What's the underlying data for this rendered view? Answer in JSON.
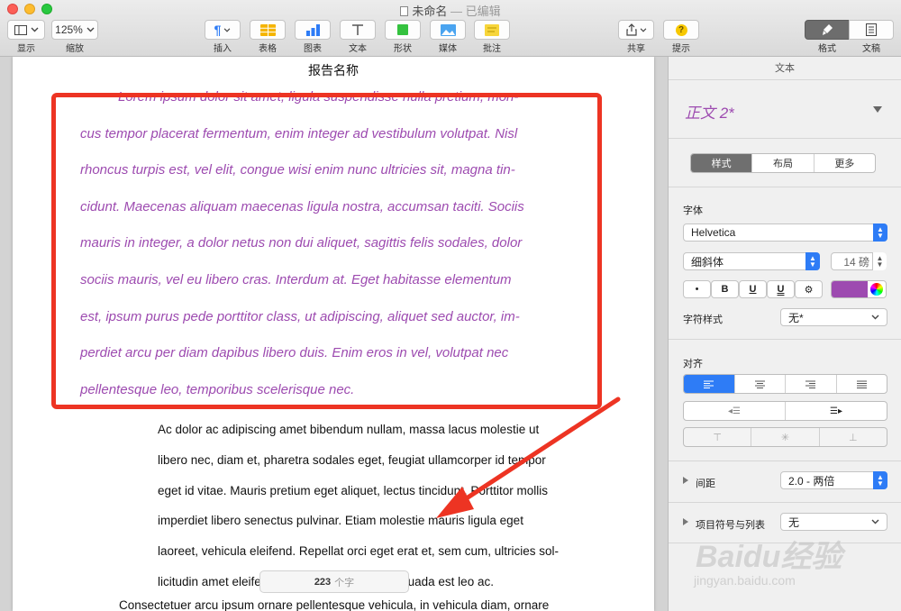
{
  "window": {
    "title": "未命名",
    "subtitle": "— 已编辑"
  },
  "toolbar": {
    "view_label": "显示",
    "zoom_value": "125%",
    "zoom_label": "缩放",
    "insert_label": "插入",
    "table_label": "表格",
    "chart_label": "图表",
    "text_label": "文本",
    "shape_label": "形状",
    "media_label": "媒体",
    "comment_label": "批注",
    "share_label": "共享",
    "tips_label": "提示",
    "format_label": "格式",
    "document_label": "文稿",
    "icons": {
      "view": "sidebar-icon",
      "insert": "pilcrow-icon",
      "table": "table-icon",
      "chart": "bar-chart-icon",
      "text": "text-t-icon",
      "shape": "square-icon",
      "media": "image-icon",
      "comment": "comment-icon",
      "share": "share-icon",
      "tips": "question-icon",
      "format": "paintbrush-icon",
      "document": "document-icon"
    }
  },
  "document": {
    "title": "报告名称",
    "italic_lines": [
      "Lorem ipsum dolor sit amet, ligula suspendisse nulla pretium, mon-",
      "cus tempor placerat fermentum, enim integer ad vestibulum volutpat. Nisl",
      "rhoncus turpis est, vel elit, congue wisi enim nunc ultricies sit, magna tin-",
      "cidunt. Maecenas aliquam maecenas ligula nostra, accumsan taciti. Sociis",
      "mauris in integer, a dolor netus non dui aliquet, sagittis felis sodales, dolor",
      "sociis mauris, vel eu libero cras. Interdum at. Eget habitasse elementum",
      "est, ipsum purus pede porttitor class, ut adipiscing, aliquet sed auctor, im-",
      "perdiet arcu per diam dapibus libero duis. Enim eros in vel, volutpat nec",
      "pellentesque leo, temporibus scelerisque nec."
    ],
    "normal_lines": [
      "Ac dolor ac adipiscing amet bibendum nullam, massa lacus molestie ut",
      "libero nec, diam et, pharetra sodales eget, feugiat ullamcorper id tempor",
      "eget id vitae. Mauris pretium eget aliquet, lectus tincidunt. Porttitor mollis",
      "imperdiet libero senectus pulvinar. Etiam molestie mauris ligula eget",
      "laoreet, vehicula eleifend. Repellat orci eget erat et, sem cum, ultricies sol-",
      "licitudin amet eleifend dolor nullam erat, malesuada est leo ac."
    ],
    "last_line": "Consectetuer arcu ipsum ornare pellentesque vehicula, in vehicula diam, ornare",
    "word_count": "223",
    "word_count_unit": "个字"
  },
  "sidebar": {
    "header": "文本",
    "paragraph_style": "正文 2*",
    "tabs": [
      "样式",
      "布局",
      "更多"
    ],
    "font_section": "字体",
    "font_family": "Helvetica",
    "font_weight": "细斜体",
    "font_size": "14 磅",
    "format_buttons": [
      "•",
      "B",
      "U",
      "U",
      "⚙"
    ],
    "text_color": "#9d4bb0",
    "char_style_label": "字符样式",
    "char_style_value": "无*",
    "align_section": "对齐",
    "spacing_label": "间距",
    "spacing_value": "2.0 - 两倍",
    "bullets_label": "项目符号与列表",
    "bullets_value": "无"
  },
  "colors": {
    "annotation": "#ed3423",
    "accent": "#2e7cf6",
    "italic_text": "#9d4bb0"
  },
  "watermark": {
    "brand": "Baidu经验",
    "url": "jingyan.baidu.com"
  }
}
